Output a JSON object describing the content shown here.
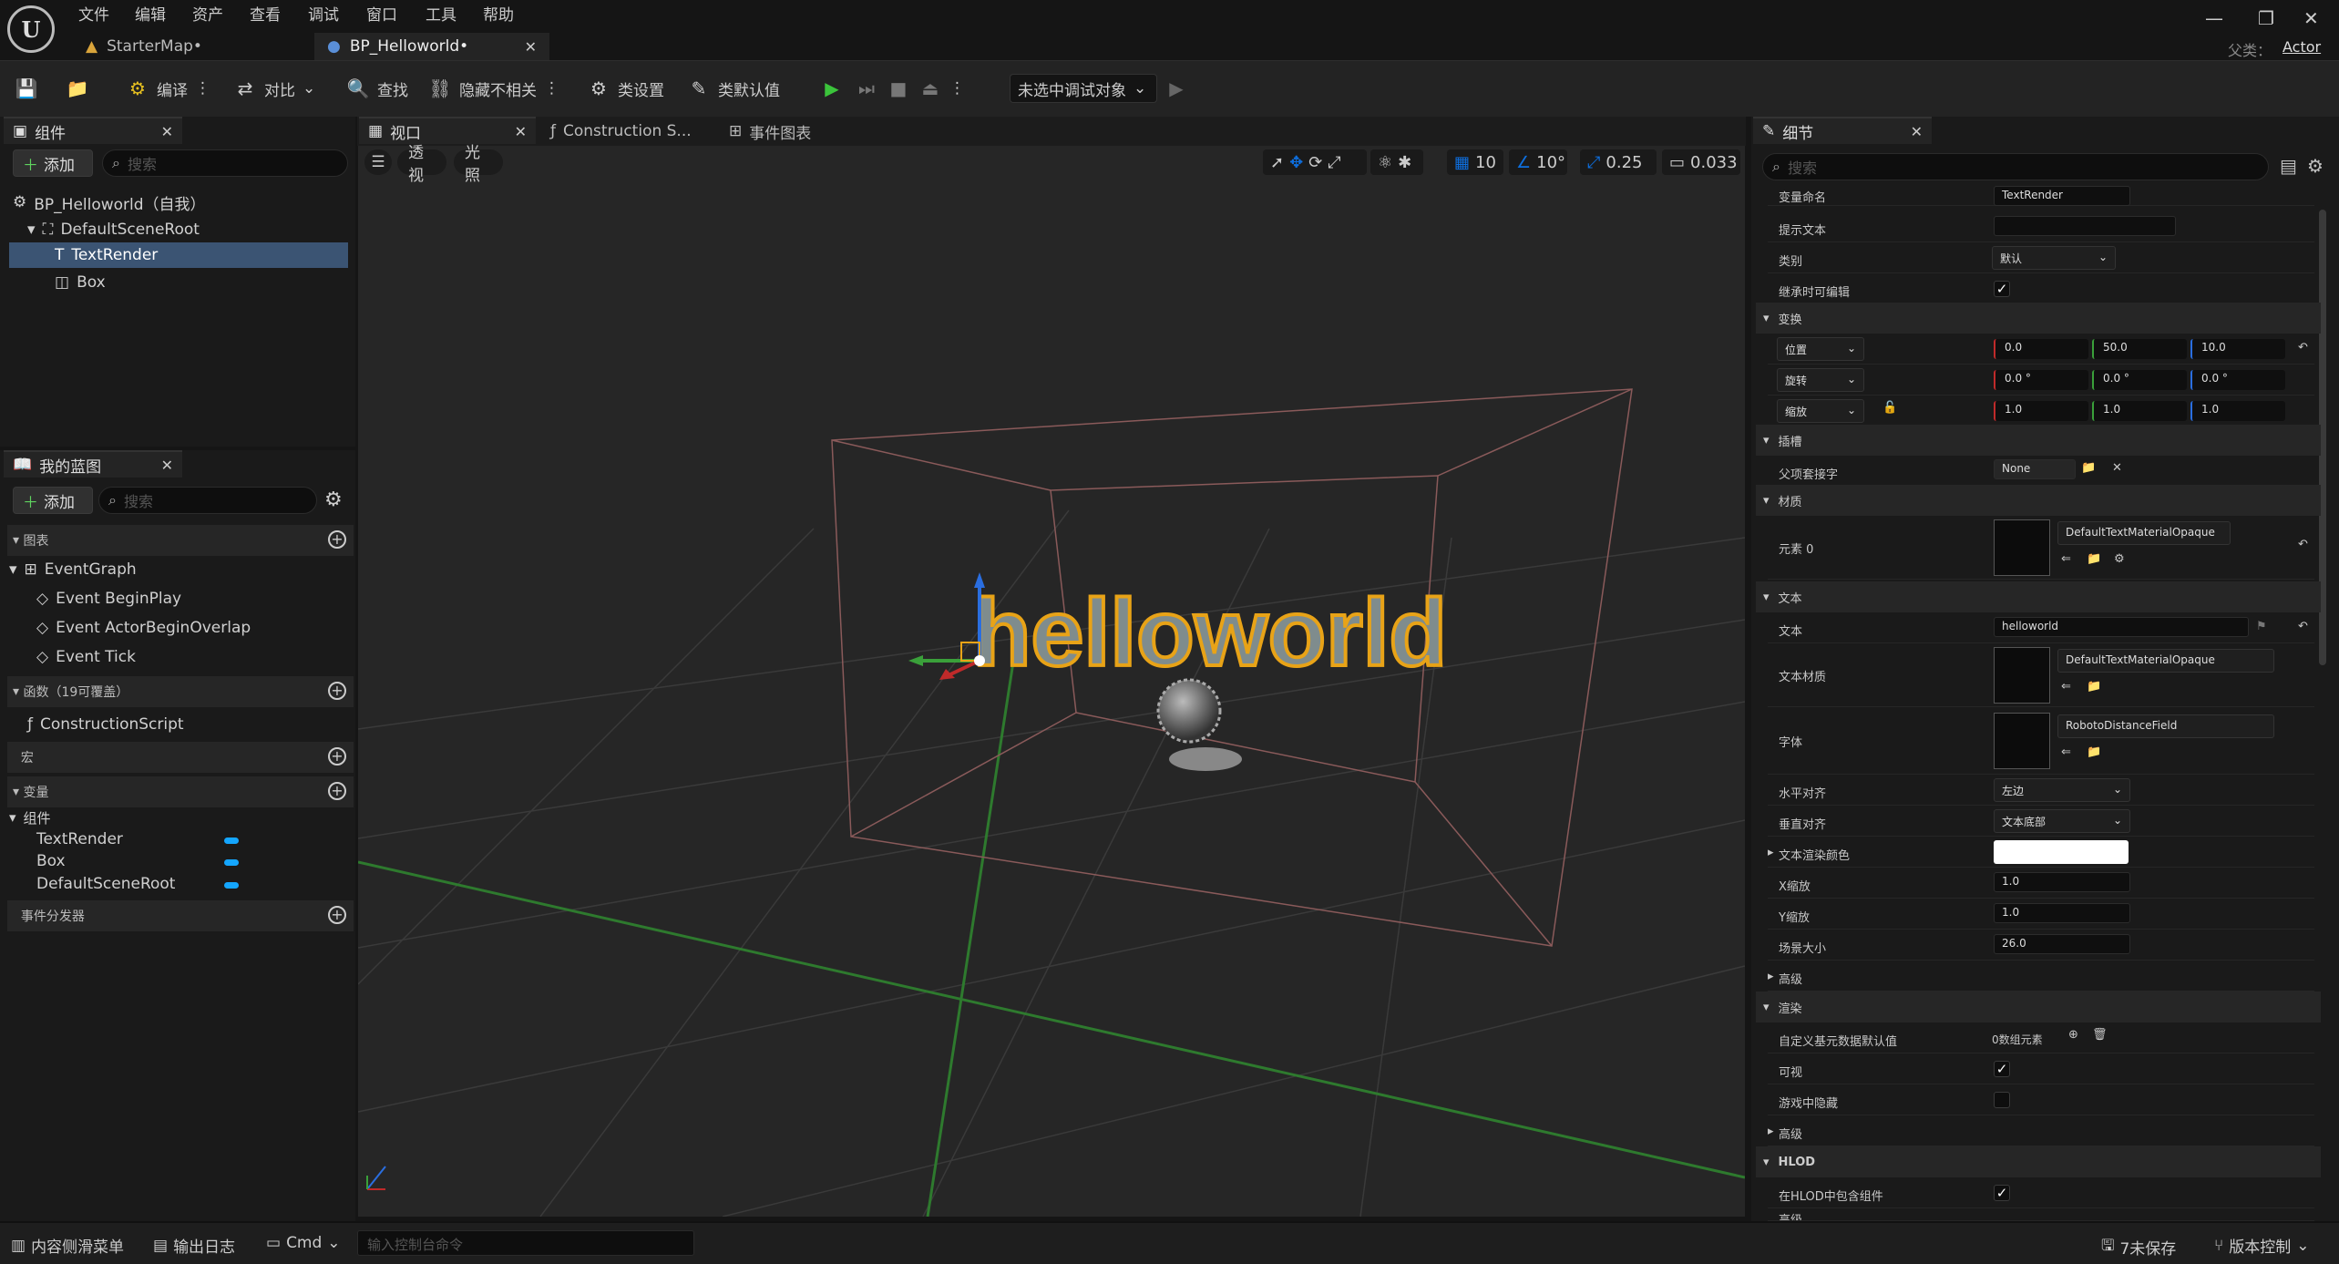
{
  "menu": [
    "文件",
    "编辑",
    "资产",
    "查看",
    "调试",
    "窗口",
    "工具",
    "帮助"
  ],
  "tabs": {
    "map": "StarterMap•",
    "bp": "BP_Helloworld•"
  },
  "parent": {
    "label": "父类：",
    "value": "Actor"
  },
  "toolbar": {
    "compile": "编译",
    "diff": "对比",
    "find": "查找",
    "hide": "隐藏不相关",
    "class_settings": "类设置",
    "class_defaults": "类默认值",
    "debug": "未选中调试对象"
  },
  "components": {
    "title": "组件",
    "add": "添加",
    "search": "搜索",
    "items": [
      "BP_Helloworld（自我）",
      "DefaultSceneRoot",
      "TextRender",
      "Box"
    ]
  },
  "mybp": {
    "title": "我的蓝图",
    "add": "添加",
    "search": "搜索",
    "graphs": "图表",
    "eventgraph": "EventGraph",
    "events": [
      "Event BeginPlay",
      "Event ActorBeginOverlap",
      "Event Tick"
    ],
    "functions": "函数（19可覆盖）",
    "construction": "ConstructionScript",
    "macros": "宏",
    "variables": "变量",
    "var_group": "组件",
    "vars": [
      "TextRender",
      "Box",
      "DefaultSceneRoot"
    ],
    "dispatchers": "事件分发器"
  },
  "center_tabs": {
    "viewport": "视口",
    "construction": "Construction S...",
    "eventgraph": "事件图表"
  },
  "viewport": {
    "perspective": "透视",
    "lit": "光照",
    "grid": "10",
    "angle": "10°",
    "scale": "0.25",
    "camera": "0.033",
    "text": "helloworld"
  },
  "details": {
    "title": "细节",
    "search": "搜索",
    "var_name_label": "变量命名",
    "var_name": "TextRender",
    "tooltip_label": "提示文本",
    "category_label": "类别",
    "category": "默认",
    "editable_label": "继承时可编辑",
    "transform": "变换",
    "loc_label": "位置",
    "rot_label": "旋转",
    "scale_label": "缩放",
    "loc": [
      "0.0",
      "50.0",
      "10.0"
    ],
    "rot": [
      "0.0 °",
      "0.0 °",
      "0.0 °"
    ],
    "scl": [
      "1.0",
      "1.0",
      "1.0"
    ],
    "sockets": "插槽",
    "parent_socket_label": "父项套接字",
    "parent_socket": "None",
    "materials": "材质",
    "element0": "元素 0",
    "mat": "DefaultTextMaterialOpaque",
    "text_section": "文本",
    "text_label": "文本",
    "text_value": "helloworld",
    "text_material_label": "文本材质",
    "text_material": "DefaultTextMaterialOpaque",
    "font_label": "字体",
    "font": "RobotoDistanceField",
    "halign_label": "水平对齐",
    "halign": "左边",
    "valign_label": "垂直对齐",
    "valign": "文本底部",
    "color_label": "文本渲染颜色",
    "xscale_label": "X缩放",
    "xscale": "1.0",
    "yscale_label": "Y缩放",
    "yscale": "1.0",
    "worldsize_label": "场景大小",
    "worldsize": "26.0",
    "advanced": "高级",
    "rendering": "渲染",
    "custom_prim_label": "自定义基元数据默认值",
    "custom_prim": "0数组元素",
    "visible_label": "可视",
    "hidden_label": "游戏中隐藏",
    "advanced2": "高级",
    "hlod": "HLOD",
    "hlod_include_label": "在HLOD中包含组件",
    "more": "高级"
  },
  "status": {
    "drawer": "内容侧滑菜单",
    "log": "输出日志",
    "cmd": "Cmd",
    "console": "输入控制台命令",
    "unsaved": "7未保存",
    "vc": "版本控制"
  },
  "colors": {
    "accent": "#0d6fe0",
    "text_orange": "#e8a317",
    "bg": "#1a1a1a"
  }
}
